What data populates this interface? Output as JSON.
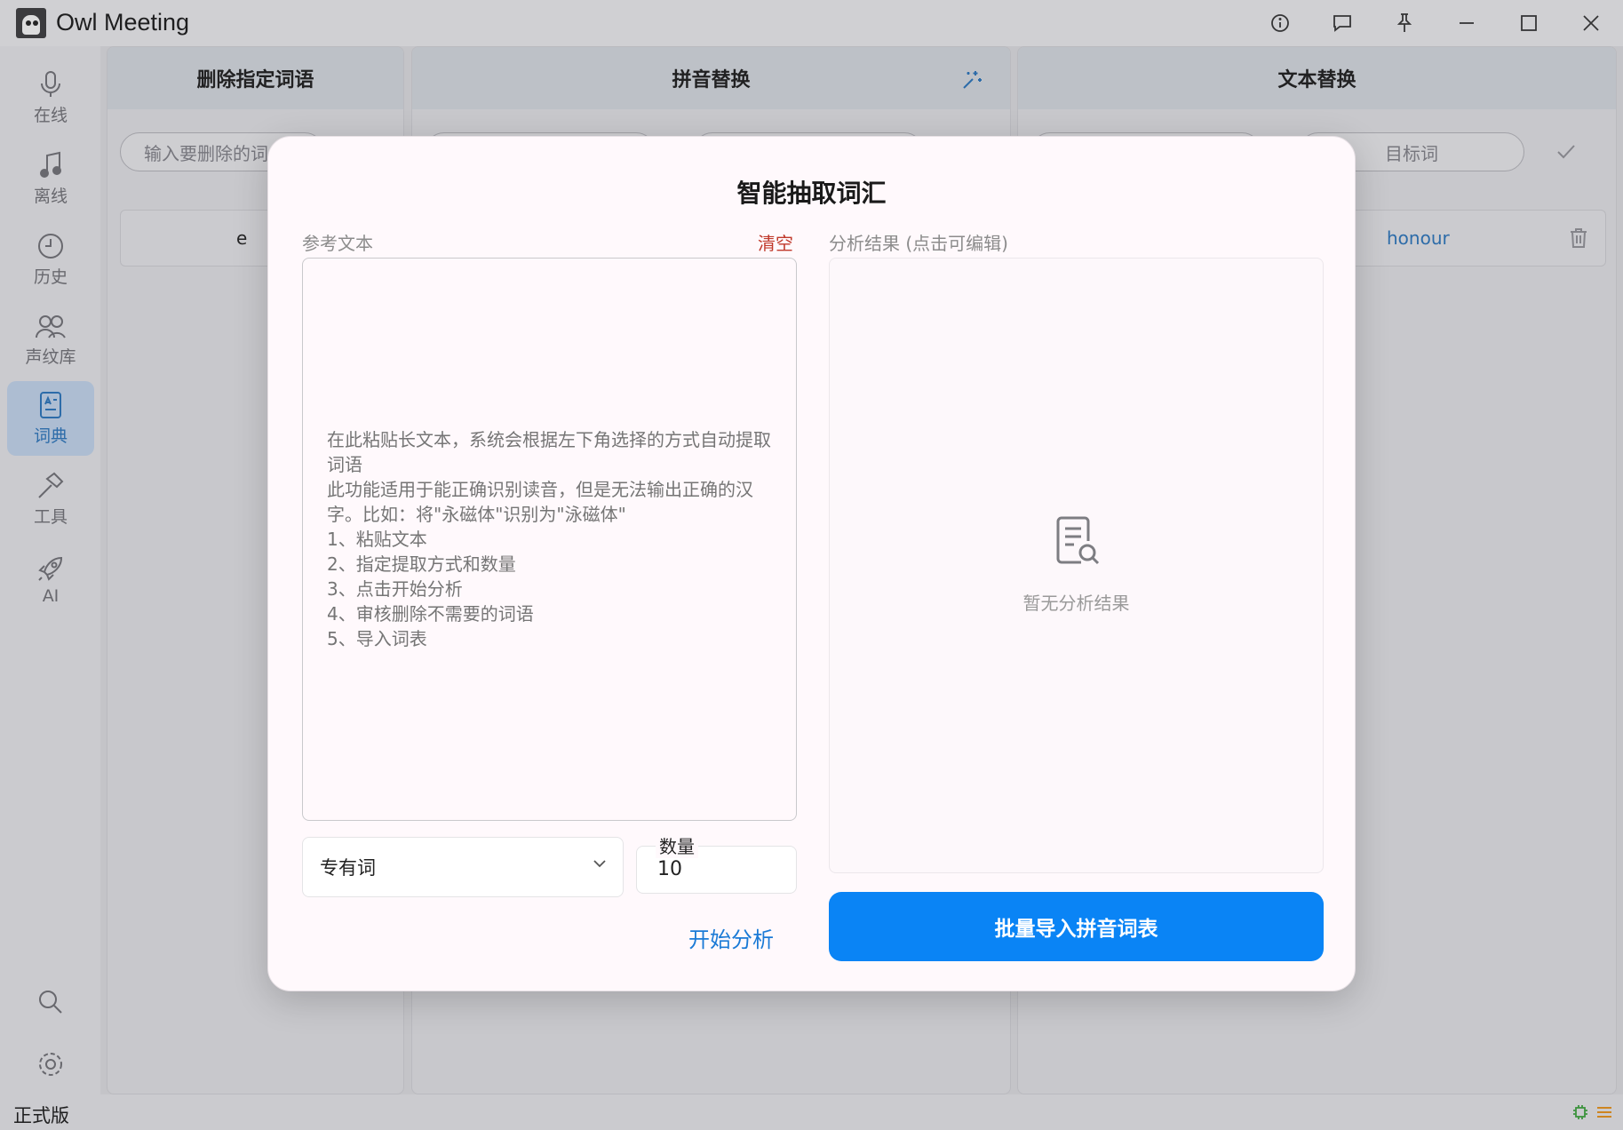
{
  "app": {
    "title": "Owl Meeting"
  },
  "sidebar": {
    "items": [
      {
        "label": "在线",
        "icon": "microphone-icon"
      },
      {
        "label": "离线",
        "icon": "music-note-icon"
      },
      {
        "label": "历史",
        "icon": "clock-icon"
      },
      {
        "label": "声纹库",
        "icon": "users-icon"
      },
      {
        "label": "词典",
        "icon": "dictionary-icon",
        "active": true
      },
      {
        "label": "工具",
        "icon": "hammer-icon"
      },
      {
        "label": "AI",
        "icon": "rocket-icon"
      }
    ],
    "bottom_icons": [
      "search-icon",
      "settings-gear-icon"
    ]
  },
  "panels": {
    "delete_words": {
      "title": "删除指定词语",
      "input_placeholder": "输入要删除的词",
      "row_text": "e"
    },
    "pinyin_replace": {
      "title": "拼音替换"
    },
    "text_replace": {
      "title": "文本替换",
      "target_placeholder": "目标词",
      "row_target": "honour"
    }
  },
  "status": {
    "edition": "正式版"
  },
  "modal": {
    "title": "智能抽取词汇",
    "ref_label": "参考文本",
    "clear_label": "清空",
    "result_label": "分析结果 (点击可编辑)",
    "textarea_placeholder": "在此粘贴长文本，系统会根据左下角选择的方式自动提取词语\n此功能适用于能正确识别读音，但是无法输出正确的汉字。比如：将\"永磁体\"识别为\"泳磁体\"\n1、粘贴文本\n2、指定提取方式和数量\n3、点击开始分析\n4、审核删除不需要的词语\n5、导入词表",
    "empty_result": "暂无分析结果",
    "extract_type": "专有词",
    "count_label": "数量",
    "count_value": "10",
    "start_button": "开始分析",
    "import_button": "批量导入拼音词表"
  },
  "colors": {
    "accent": "#0a84f5",
    "link": "#1a7ad6",
    "danger": "#c0392b",
    "active_nav": "#2b6fb0"
  }
}
